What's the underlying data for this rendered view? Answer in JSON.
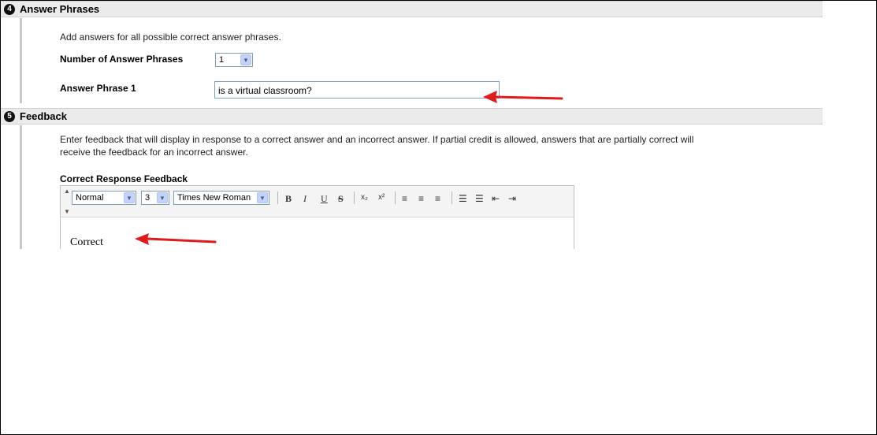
{
  "answer_phrases": {
    "step": "4",
    "title": "Answer Phrases",
    "description": "Add answers for all possible correct answer phrases.",
    "number_label": "Number of Answer Phrases",
    "number_value": "1",
    "phrase1_label": "Answer Phrase 1",
    "phrase1_value": "is a virtual classroom?"
  },
  "feedback": {
    "step": "5",
    "title": "Feedback",
    "description_line1": "Enter feedback that will display in response to a correct answer and an incorrect answer. If partial credit is allowed, answers that are partially correct will",
    "description_line2": "receive the feedback for an incorrect answer.",
    "correct_label": "Correct Response Feedback",
    "toolbar": {
      "format": "Normal",
      "size": "3",
      "font": "Times New Roman",
      "bold": "B",
      "italic": "I",
      "underline": "U",
      "strike": "S",
      "subscript": "x₂",
      "superscript": "x²"
    },
    "editor_text": "Correct"
  },
  "annotation_color": "#e01b1b"
}
